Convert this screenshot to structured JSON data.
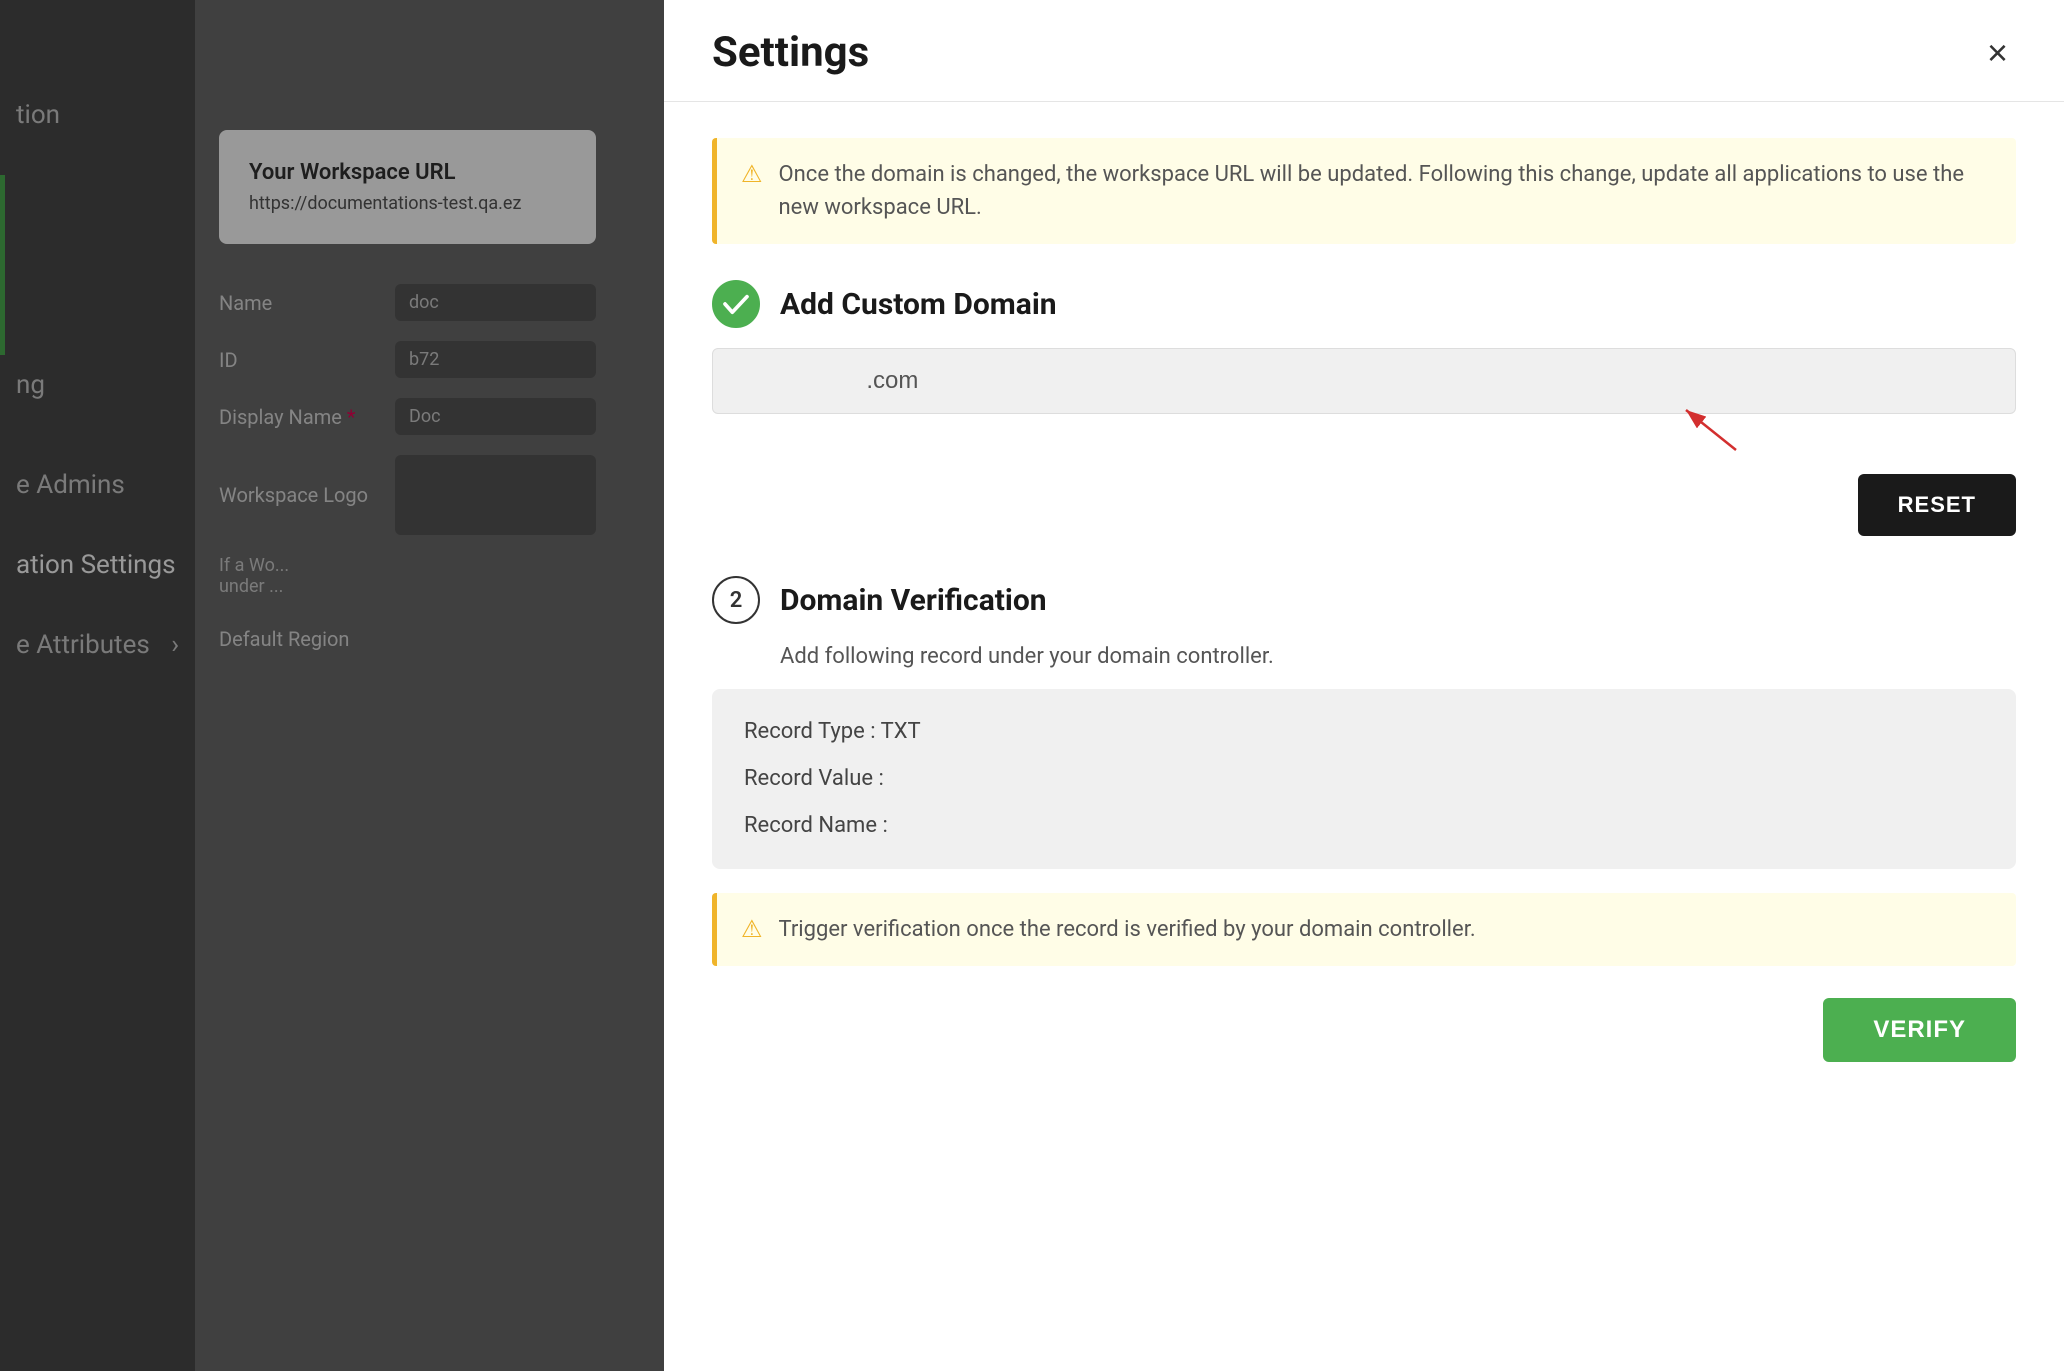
{
  "background": {
    "sidebar": {
      "items": [
        {
          "label": "tion",
          "active": false
        },
        {
          "label": "ng",
          "active": false
        },
        {
          "label": "e Admins",
          "active": false
        },
        {
          "label": "ation Settings",
          "active": true
        },
        {
          "label": "e Attributes",
          "active": false
        }
      ]
    },
    "content": {
      "workspace_url_label": "Your Workspace URL",
      "workspace_url_value": "https://documentations-test.qa.ez",
      "fields": [
        {
          "label": "Name",
          "value": "doc"
        },
        {
          "label": "ID",
          "value": "b72"
        },
        {
          "label": "Display Name",
          "value": "Doc",
          "required": true
        },
        {
          "label": "Workspace Logo",
          "value": ""
        }
      ],
      "footer_text": "If a Wo... under ...",
      "default_region_label": "Default Region"
    }
  },
  "modal": {
    "title": "Settings",
    "close_label": "×",
    "warning_banner": {
      "icon": "⚠",
      "text": "Once the domain is changed, the workspace URL will be updated. Following this change, update all applications to use the new workspace URL."
    },
    "add_custom_domain": {
      "step": "✓",
      "step_completed": true,
      "title": "Add Custom Domain",
      "input_value": ".com",
      "input_placeholder": ".com",
      "reset_button_label": "RESET"
    },
    "domain_verification": {
      "step": "2",
      "step_completed": false,
      "title": "Domain Verification",
      "description": "Add following record under your domain controller.",
      "record_type": "Record Type : TXT",
      "record_value": "Record Value :",
      "record_name": "Record Name :",
      "warning_icon": "⚠",
      "warning_text": "Trigger verification once the record is verified by your domain controller.",
      "verify_button_label": "VERIFY"
    }
  }
}
